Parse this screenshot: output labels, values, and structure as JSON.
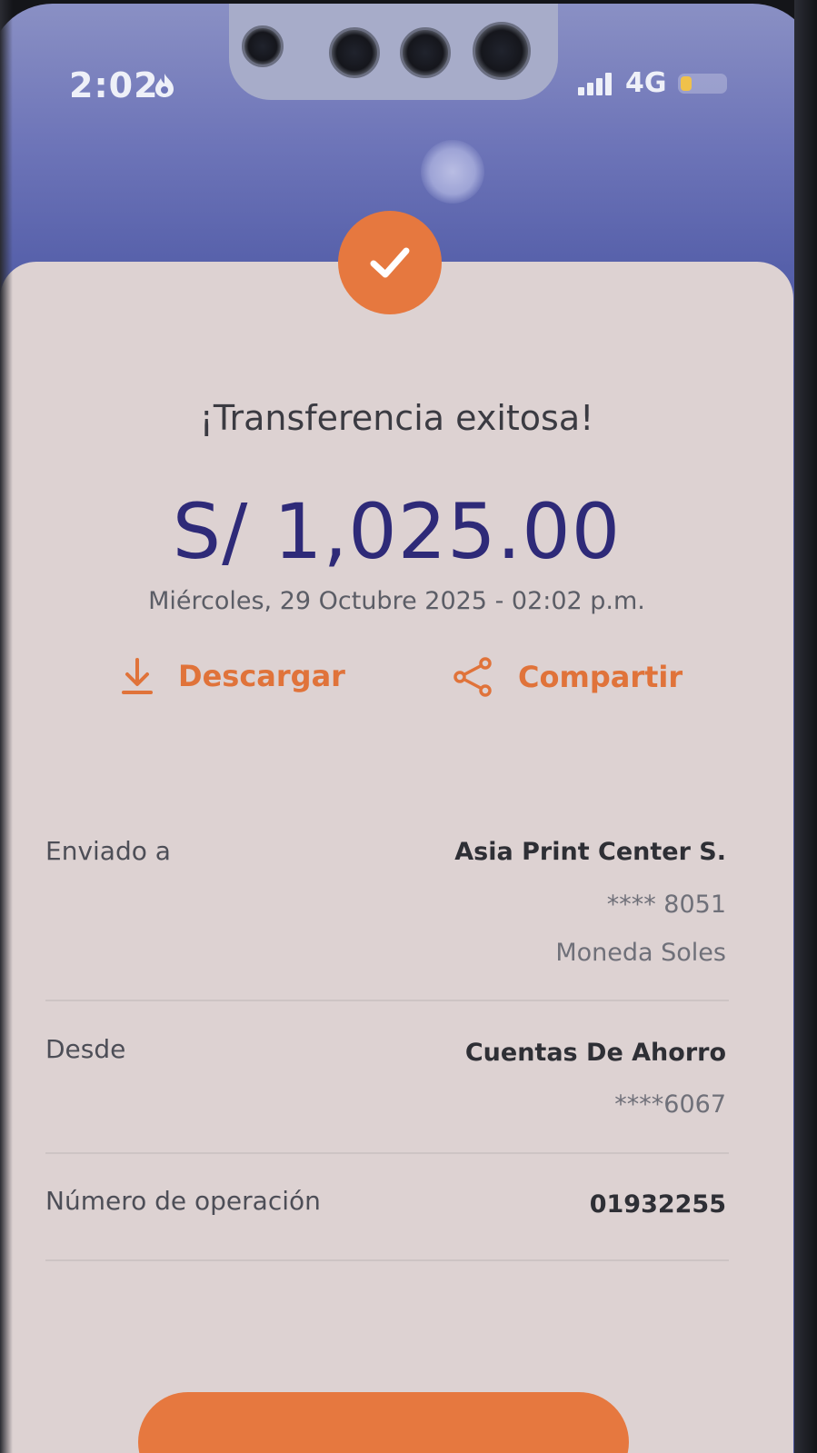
{
  "status_bar": {
    "time": "2:02",
    "network": "4G"
  },
  "receipt": {
    "title": "¡Transferencia exitosa!",
    "amount": "S/ 1,025.00",
    "datetime": "Miércoles, 29 Octubre 2025 - 02:02 p.m."
  },
  "actions": {
    "download_label": "Descargar",
    "share_label": "Compartir"
  },
  "details": {
    "sent_to": {
      "label": "Enviado a",
      "name": "Asia Print Center S.",
      "account": "**** 8051",
      "currency": "Moneda Soles"
    },
    "from": {
      "label": "Desde",
      "account_type": "Cuentas De Ahorro",
      "account": "****6067"
    },
    "operation": {
      "label": "Número de operación",
      "number": "01932255"
    }
  },
  "colors": {
    "accent": "#e6783f",
    "amount": "#2e2a78",
    "card": "#ddd2d2"
  },
  "icons": {
    "success": "check-icon",
    "download": "download-icon",
    "share": "share-icon"
  }
}
